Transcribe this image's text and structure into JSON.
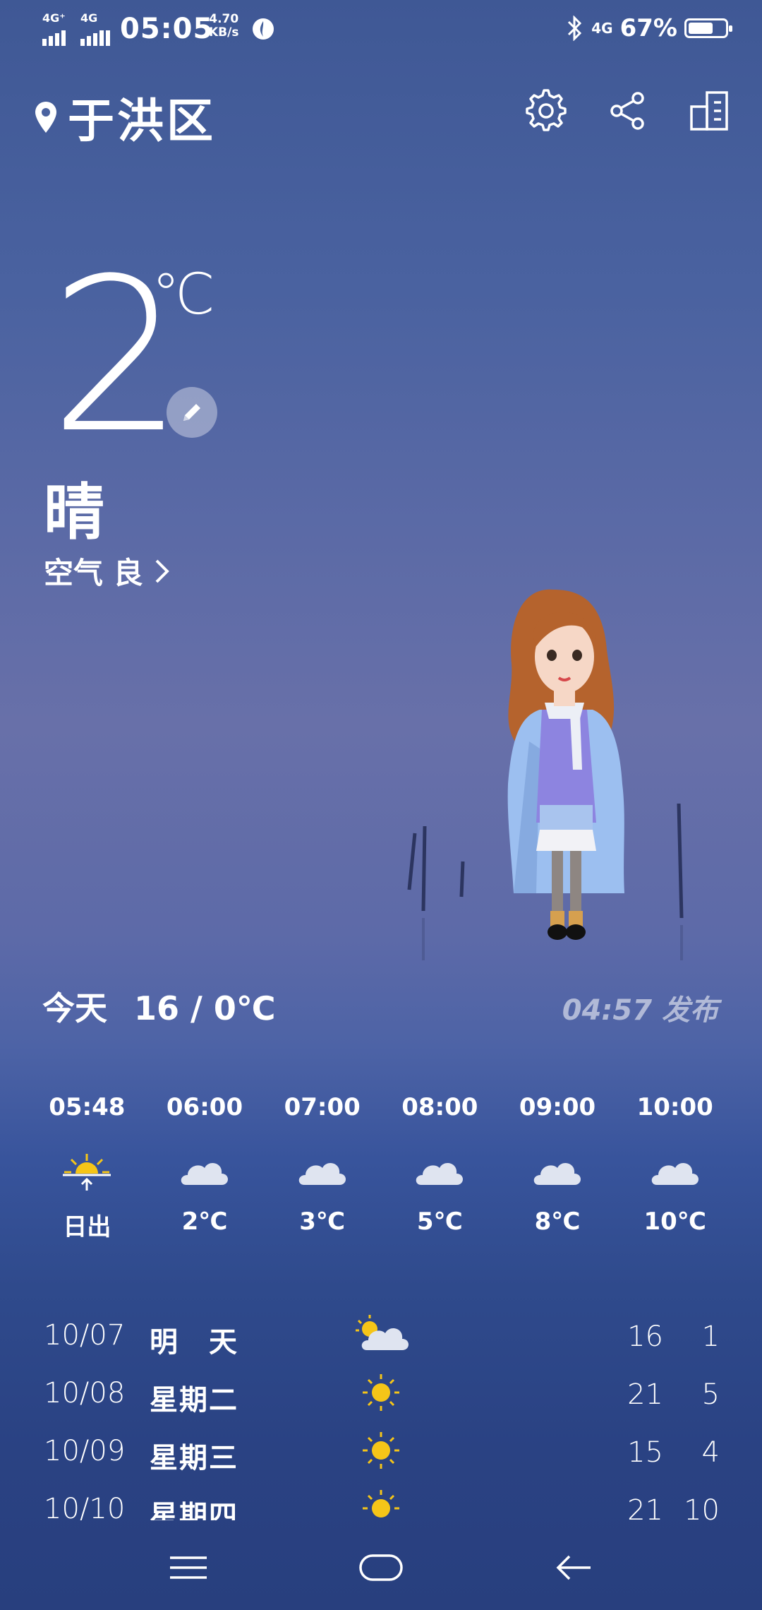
{
  "status_bar": {
    "signal1": "4G⁺",
    "signal2": "4G",
    "time": "05:05",
    "speed_value": "4.70",
    "speed_unit": "KB/s",
    "network_right": "4G",
    "battery_text": "67%",
    "battery_level": 0.67
  },
  "header": {
    "location": "于洪区",
    "icons": [
      "location-pin-icon",
      "settings-gear-icon",
      "share-icon",
      "city-manage-icon"
    ]
  },
  "current": {
    "temperature": "2",
    "unit": "℃",
    "condition": "晴",
    "air_quality": "空气 良"
  },
  "today": {
    "label": "今天",
    "range": "16 / 0℃",
    "published": "04:57 发布"
  },
  "hourly": [
    {
      "time": "05:48",
      "icon": "sunrise",
      "value": "日出"
    },
    {
      "time": "06:00",
      "icon": "cloudy",
      "value": "2℃"
    },
    {
      "time": "07:00",
      "icon": "cloudy",
      "value": "3℃"
    },
    {
      "time": "08:00",
      "icon": "cloudy",
      "value": "5℃"
    },
    {
      "time": "09:00",
      "icon": "cloudy",
      "value": "8℃"
    },
    {
      "time": "10:00",
      "icon": "cloudy",
      "value": "10℃"
    }
  ],
  "daily": [
    {
      "date": "10/07",
      "weekday": "明　天",
      "icon": "partly-cloudy",
      "high": "16",
      "low": "1"
    },
    {
      "date": "10/08",
      "weekday": "星期二",
      "icon": "sunny",
      "high": "21",
      "low": "5"
    },
    {
      "date": "10/09",
      "weekday": "星期三",
      "icon": "sunny",
      "high": "15",
      "low": "4"
    },
    {
      "date": "10/10",
      "weekday": "星期四",
      "icon": "sunny",
      "high": "21",
      "low": "10"
    }
  ],
  "colors": {
    "sun": "#f5c518",
    "cloud": "#dfe4f0"
  }
}
